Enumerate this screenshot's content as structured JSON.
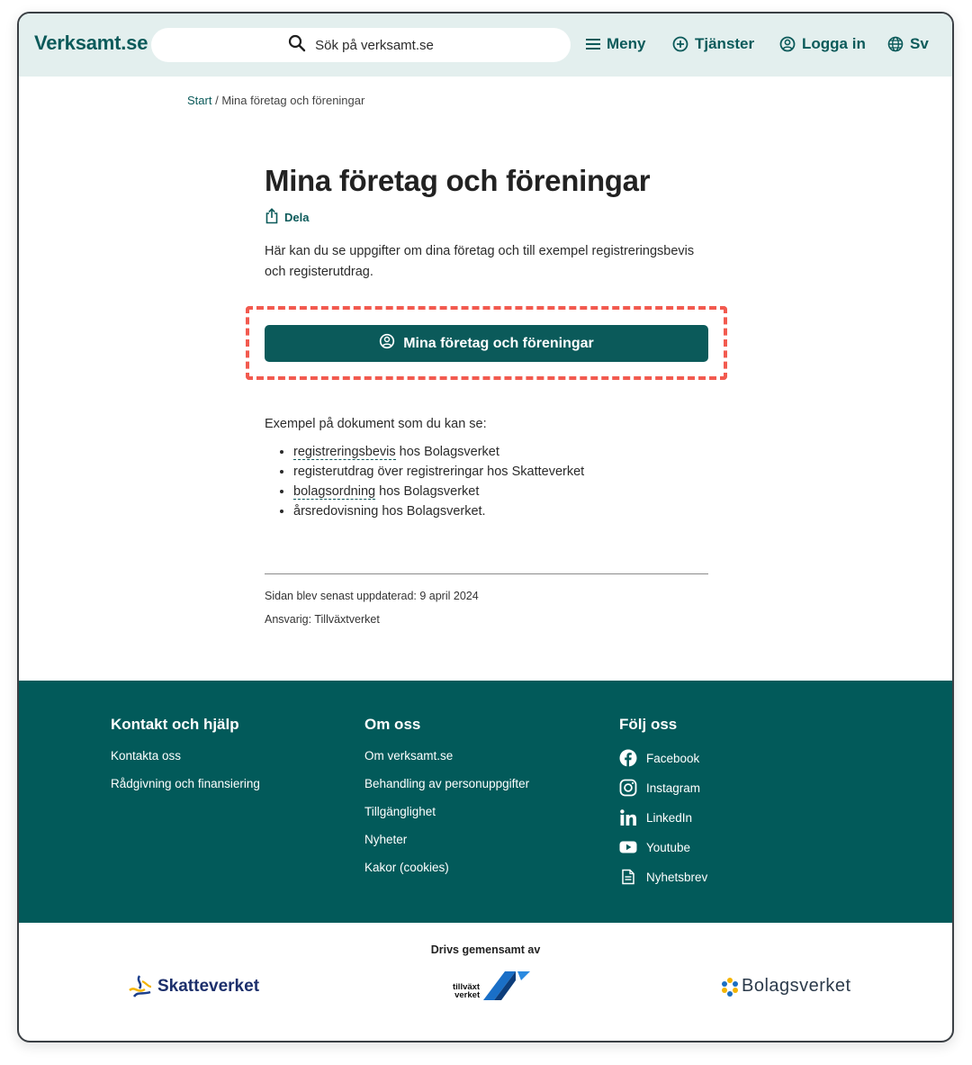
{
  "header": {
    "logo": "Verksamt.se",
    "search_placeholder": "Sök på verksamt.se",
    "menu_label": "Meny",
    "services_label": "Tjänster",
    "login_label": "Logga in",
    "language_label": "Sv"
  },
  "breadcrumb": {
    "start": "Start",
    "separator": "/",
    "current": "Mina företag och föreningar"
  },
  "main": {
    "title": "Mina företag och föreningar",
    "share_label": "Dela",
    "intro": "Här kan du se uppgifter om dina företag och till exempel registreringsbevis och registerutdrag.",
    "cta_label": "Mina företag och föreningar",
    "examples_intro": "Exempel på dokument som du kan se:",
    "examples": [
      {
        "term": "registreringsbevis",
        "rest": " hos Bolagsverket"
      },
      {
        "term": "",
        "rest": "registerutdrag över registreringar hos Skatteverket"
      },
      {
        "term": "bolagsordning",
        "rest": " hos Bolagsverket"
      },
      {
        "term": "",
        "rest": "årsredovisning hos Bolagsverket."
      }
    ],
    "updated": "Sidan blev senast uppdaterad: 9 april 2024",
    "responsible": "Ansvarig: Tillväxtverket"
  },
  "footer": {
    "col1": {
      "heading": "Kontakt och hjälp",
      "links": [
        "Kontakta oss",
        "Rådgivning och finansiering"
      ]
    },
    "col2": {
      "heading": "Om oss",
      "links": [
        "Om verksamt.se",
        "Behandling av personuppgifter",
        "Tillgänglighet",
        "Nyheter",
        "Kakor (cookies)"
      ]
    },
    "col3": {
      "heading": "Följ oss",
      "links": [
        {
          "label": "Facebook",
          "icon": "facebook-icon"
        },
        {
          "label": "Instagram",
          "icon": "instagram-icon"
        },
        {
          "label": "LinkedIn",
          "icon": "linkedin-icon"
        },
        {
          "label": "Youtube",
          "icon": "youtube-icon"
        },
        {
          "label": "Nyhetsbrev",
          "icon": "newsletter-icon"
        }
      ]
    }
  },
  "partners": {
    "label": "Drivs gemensamt av",
    "skatteverket": "Skatteverket",
    "tillvaxtverket_line1": "tillväxt",
    "tillvaxtverket_line2": "verket",
    "bolagsverket": "Bolagsverket"
  },
  "colors": {
    "brand": "#0b5a5a",
    "header_bg": "#e3efee",
    "footer_bg": "#025a5a",
    "highlight": "#f25a4f"
  }
}
